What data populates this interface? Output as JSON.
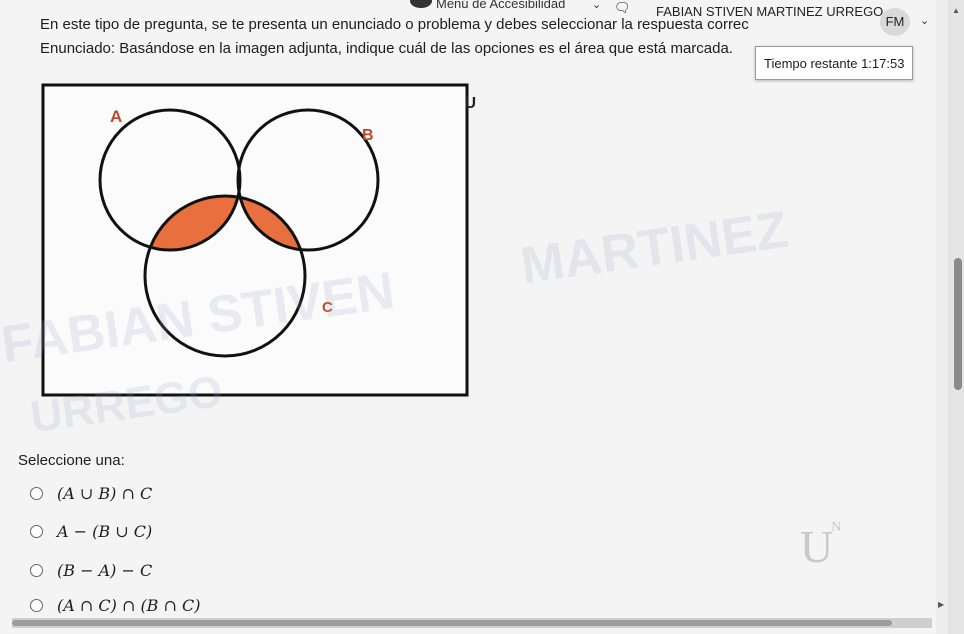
{
  "header": {
    "accessibility_label": "Menú de Accesibilidad",
    "chevron_glyph": "⌄",
    "notification_glyph": "🗨",
    "user_name": "FABIAN STIVEN MARTINEZ URREGO",
    "avatar_initials": "FM"
  },
  "question": {
    "intro": "En este tipo de pregunta, se te presenta un enunciado o problema y debes seleccionar la respuesta correc",
    "statement": "Enunciado: Basándose en la imagen adjunta, indique cuál de las opciones es el área que está marcada."
  },
  "timer": {
    "label": "Tiempo restante",
    "value": "1:17:53"
  },
  "diagram": {
    "universe_label": "U",
    "set_a_label": "A",
    "set_b_label": "B",
    "set_c_label": "C",
    "shade_color": "#e8703e"
  },
  "watermark": {
    "line1": "MARTINEZ",
    "line2": "FABIAN STIVEN",
    "line3": "URREGO"
  },
  "answers": {
    "prompt": "Seleccione una:",
    "options": [
      "(A ∪ B) ∩ C",
      "A − (B ∪ C)",
      "(B − A) − C",
      "(A ∩ C) ∩ (B ∩ C)"
    ]
  },
  "logo": {
    "text": "U",
    "sup": "N"
  }
}
